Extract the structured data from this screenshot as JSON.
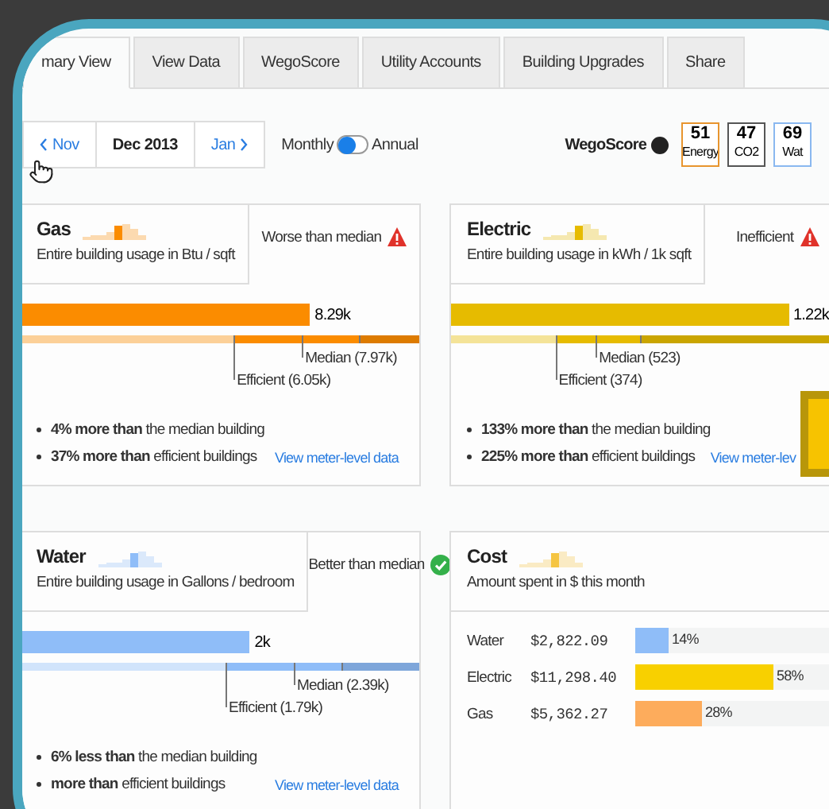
{
  "tabs": [
    {
      "label": "mary View",
      "selected": true
    },
    {
      "label": "View Data",
      "selected": false
    },
    {
      "label": "WegoScore",
      "selected": false
    },
    {
      "label": "Utility Accounts",
      "selected": false
    },
    {
      "label": "Building Upgrades",
      "selected": false
    },
    {
      "label": "Share",
      "selected": false
    }
  ],
  "date_nav": {
    "prev": "Nov",
    "current": "Dec 2013",
    "next": "Jan"
  },
  "period_toggle": {
    "left": "Monthly",
    "right": "Annual",
    "on": false
  },
  "wegoscore": {
    "label": "WegoScore",
    "scores": [
      {
        "value": "51",
        "label": "Energy",
        "color": "#e8952e"
      },
      {
        "value": "47",
        "label": "CO2",
        "color": "#555555"
      },
      {
        "value": "69",
        "label": "Wat",
        "color": "#8ab8f0"
      }
    ]
  },
  "panels": [
    {
      "kind": "usage",
      "title": "Gas",
      "subtitle": "Entire building usage in Btu / sqft",
      "color": "#fb8c00",
      "status": {
        "text": "Worse than median",
        "kind": "warning"
      },
      "bar": {
        "level": 0.72,
        "value": "8.29k"
      },
      "markers": [
        {
          "label": "Median (7.97k)",
          "level": 0.7
        },
        {
          "label": "Efficient (6.05k)",
          "level": 0.53
        },
        {
          "level": 0.84
        }
      ],
      "bullets": [
        "**4% more than** the median building",
        "**37% more than** efficient buildings"
      ],
      "link": "View meter-level data"
    },
    {
      "kind": "usage",
      "title": "Electric",
      "subtitle": "Entire building usage in kWh / 1k sqft",
      "color": "#e6bb00",
      "status": {
        "text": "Inefficient",
        "kind": "warning"
      },
      "bar": {
        "level": 0.84,
        "value": "1.22k"
      },
      "markers": [
        {
          "label": "Median (523)",
          "level": 0.36
        },
        {
          "label": "Efficient (374)",
          "level": 0.26
        },
        {
          "level": 0.47
        }
      ],
      "bullets": [
        "**133% more than** the median building",
        "**225% more than** efficient buildings"
      ],
      "link": "View meter-lev"
    },
    {
      "kind": "usage",
      "title": "Water",
      "subtitle": "Entire building usage in Gallons / bedroom",
      "color": "#8fbdf8",
      "status": {
        "text": "Better than median",
        "kind": "check"
      },
      "bar": {
        "level": 0.57,
        "value": "2k"
      },
      "markers": [
        {
          "label": "Median (2.39k)",
          "level": 0.68
        },
        {
          "label": "Efficient (1.79k)",
          "level": 0.51
        },
        {
          "level": 0.8
        }
      ],
      "bullets": [
        "**6% less than** the median building",
        "**more than** efficient buildings"
      ],
      "link": "View meter-level data"
    },
    {
      "kind": "cost",
      "title": "Cost",
      "subtitle": "Amount spent in $ this month",
      "rows": [
        {
          "name": "Water",
          "amount": "$2,822.09",
          "level": 0.14,
          "percent": "14%",
          "color": "#8fbdf8"
        },
        {
          "name": "Electric",
          "amount": "$11,298.40",
          "level": 0.58,
          "percent": "58%",
          "color": "#f8d000"
        },
        {
          "name": "Gas",
          "amount": "$5,362.27",
          "level": 0.28,
          "percent": "28%",
          "color": "#fdac5c"
        }
      ]
    }
  ]
}
